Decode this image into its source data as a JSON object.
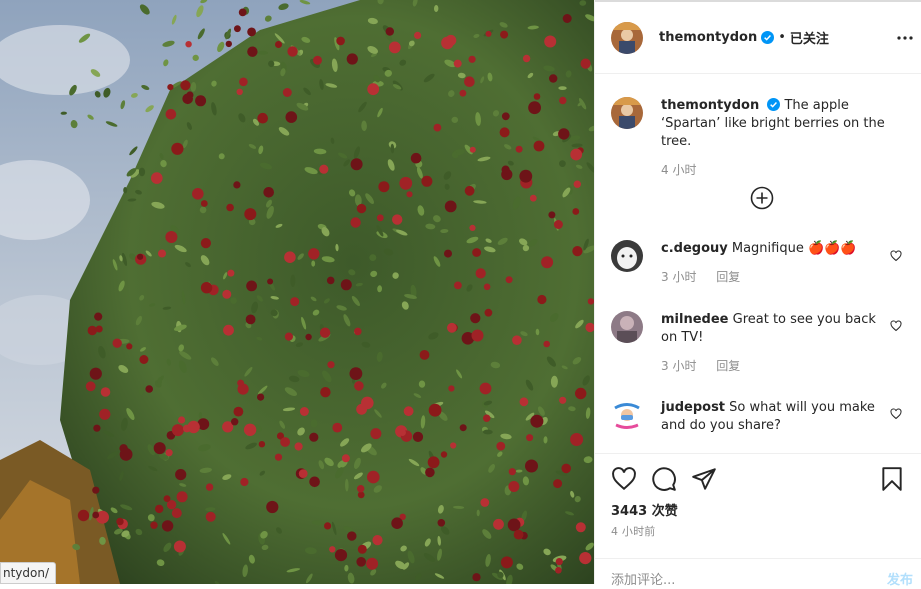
{
  "photo": {
    "url_tip": "ntydon/"
  },
  "header": {
    "username": "themontydon",
    "separator": "•",
    "follow_state": "已关注"
  },
  "caption": {
    "username": "themontydon",
    "text": "The apple ‘Spartan’ like bright berries on the tree.",
    "time": "4 小时"
  },
  "comments": [
    {
      "username": "c.degouy",
      "text": "Magnifique 🍎🍎🍎",
      "time": "3 小时",
      "reply": "回复"
    },
    {
      "username": "milnedee",
      "text": "Great to see you back on TV!",
      "time": "3 小时",
      "reply": "回复"
    },
    {
      "username": "judepost",
      "text": "So what will you make and do you share?",
      "avatar_text": "WEAR YOUR MASK"
    }
  ],
  "actions": {
    "likes": "3443 次赞",
    "time": "4 小时前"
  },
  "add_comment": {
    "placeholder": "添加评论...",
    "post": "发布"
  },
  "colors": {
    "verified": "#0095f6",
    "post_disabled": "#b2dffc",
    "apple": "#8b1a1a"
  }
}
